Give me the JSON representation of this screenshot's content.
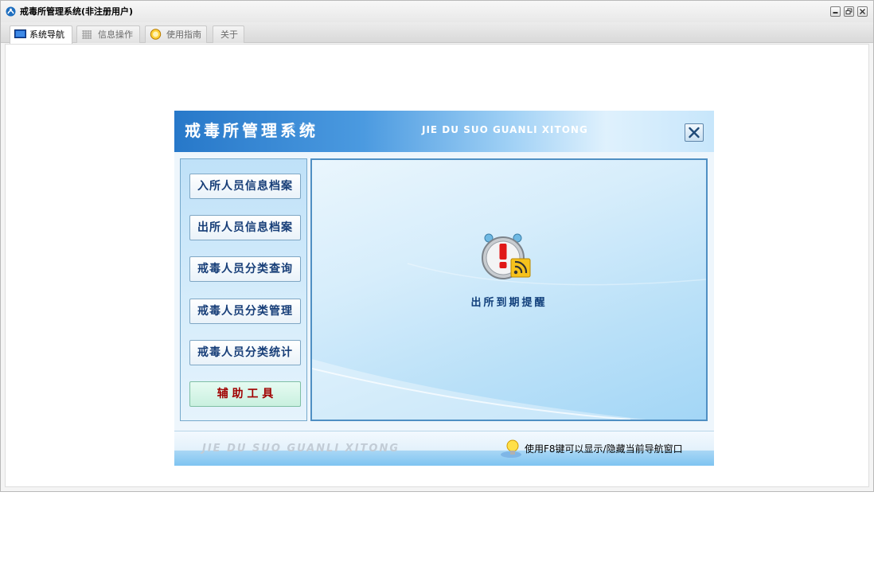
{
  "window": {
    "title": "戒毒所管理系统(非注册用户)",
    "icon": "app-logo-icon"
  },
  "tabs": [
    {
      "label": "系统导航",
      "icon": "monitor-icon",
      "active": true
    },
    {
      "label": "信息操作",
      "icon": "grid-icon",
      "active": false
    },
    {
      "label": "使用指南",
      "icon": "guide-icon",
      "active": false
    },
    {
      "label": "关于",
      "icon": "",
      "active": false
    }
  ],
  "panel": {
    "title": "戒毒所管理系统",
    "pinyin": "JIE DU SUO GUANLI XITONG",
    "close_icon": "close-icon",
    "menu": [
      {
        "label": "入所人员信息档案"
      },
      {
        "label": "出所人员信息档案"
      },
      {
        "label": "戒毒人员分类查询"
      },
      {
        "label": "戒毒人员分类管理"
      },
      {
        "label": "戒毒人员分类统计"
      },
      {
        "label": "辅 助 工 具"
      }
    ],
    "reminder": {
      "label": "出所到期提醒",
      "icon": "alarm-clock-rss-icon"
    },
    "footer": {
      "pinyin": "JIE DU SUO GUANLI XITONG",
      "hint": "使用F8键可以显示/隐藏当前导航窗口",
      "icon": "lightbulb-icon"
    }
  },
  "colors": {
    "header_blue": "#2778c9",
    "menu_text": "#173e78",
    "tools_text": "#a00000"
  }
}
